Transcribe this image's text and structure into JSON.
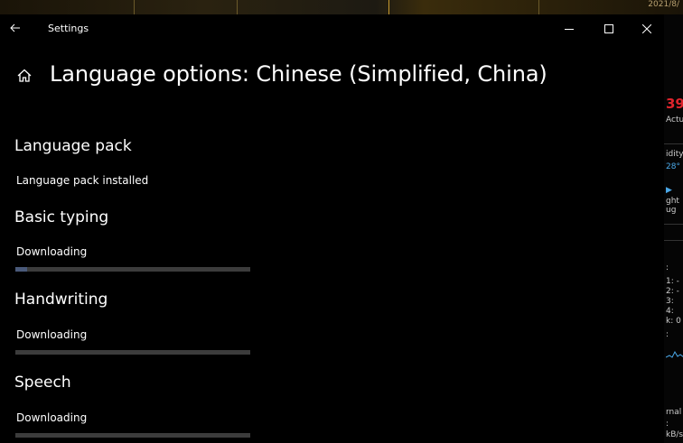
{
  "desktop": {
    "date_fragment": "2021/8/",
    "widget_lines": [
      "39",
      "Actua",
      "idity",
      "28°",
      "ght",
      "ug",
      ":",
      "1: -",
      "2: -",
      "3:",
      "4:",
      "k: 0",
      ":",
      "rnal",
      ":",
      "kB/s"
    ]
  },
  "window": {
    "app_title": "Settings",
    "page_title": "Language options: Chinese (Simplified, China)"
  },
  "sections": [
    {
      "heading": "Language pack",
      "status": "Language pack installed",
      "progress": null
    },
    {
      "heading": "Basic typing",
      "status": "Downloading",
      "progress": 0.05
    },
    {
      "heading": "Handwriting",
      "status": "Downloading",
      "progress": 0.0
    },
    {
      "heading": "Speech",
      "status": "Downloading",
      "progress": 0.0
    }
  ],
  "colors": {
    "background": "#000000",
    "text": "#ffffff",
    "progress_track": "#3c3c3c",
    "progress_fill": "#4a5a7a"
  },
  "icons": {
    "back": "back-arrow-icon",
    "home": "home-icon",
    "minimize": "minimize-icon",
    "maximize": "maximize-icon",
    "close": "close-icon"
  }
}
